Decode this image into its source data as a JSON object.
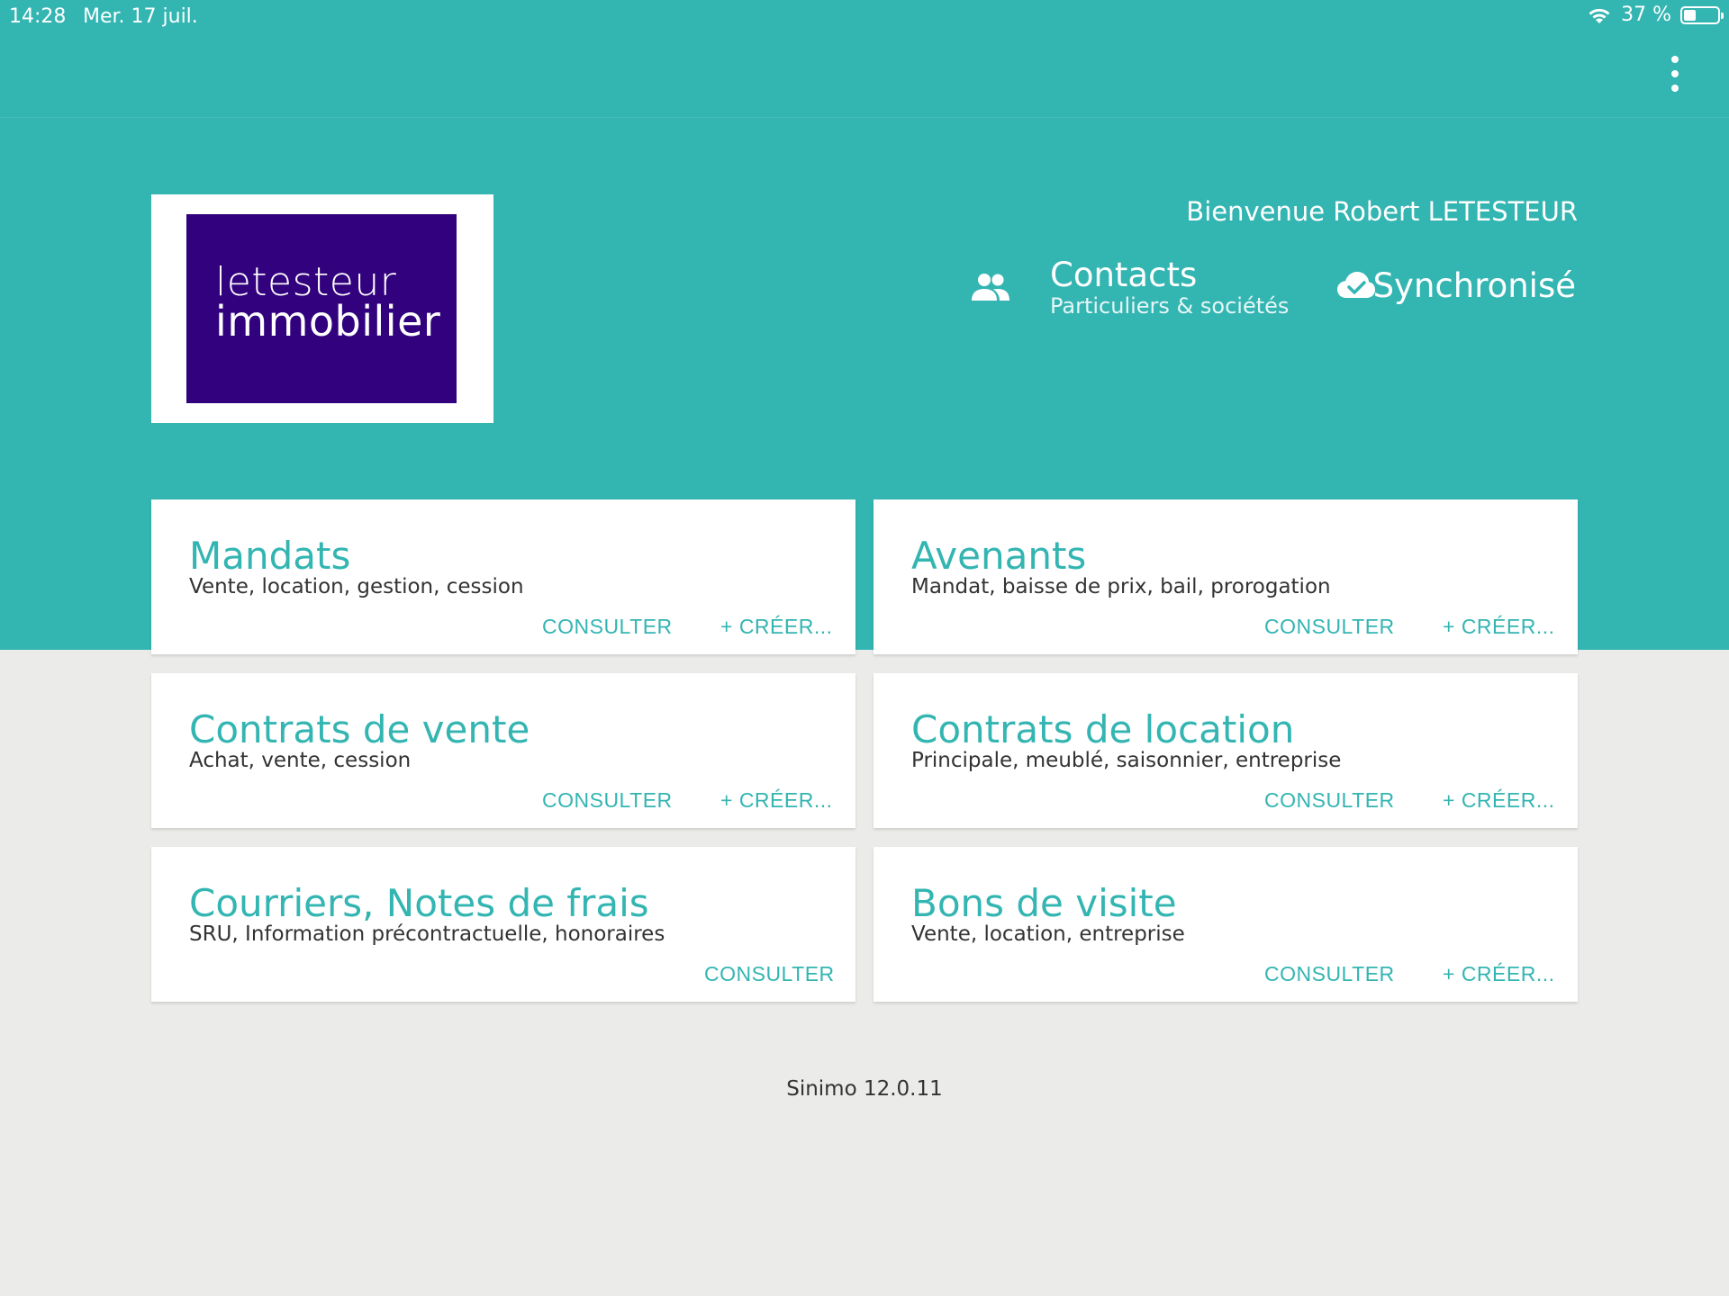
{
  "status_bar": {
    "time": "14:28",
    "date": "Mer. 17 juil.",
    "battery": "37 %",
    "battery_level": 0.37
  },
  "header": {
    "logo": {
      "line1": "letesteur",
      "line2": "immobilier"
    },
    "welcome": "Bienvenue Robert LETESTEUR",
    "contacts": {
      "title": "Contacts",
      "subtitle": "Particuliers & sociétés"
    },
    "sync_label": "Synchronisé"
  },
  "cards": [
    {
      "title": "Mandats",
      "subtitle": "Vente, location, gestion, cession",
      "consult_label": "CONSULTER",
      "create_label": "+ CRÉER..."
    },
    {
      "title": "Avenants",
      "subtitle": "Mandat, baisse de prix, bail, prorogation",
      "consult_label": "CONSULTER",
      "create_label": "+ CRÉER..."
    },
    {
      "title": "Contrats de vente",
      "subtitle": "Achat, vente, cession",
      "consult_label": "CONSULTER",
      "create_label": "+ CRÉER..."
    },
    {
      "title": "Contrats de location",
      "subtitle": "Principale, meublé, saisonnier, entreprise",
      "consult_label": "CONSULTER",
      "create_label": "+ CRÉER..."
    },
    {
      "title": "Courriers, Notes de frais",
      "subtitle": "SRU, Information précontractuelle, honoraires",
      "consult_label": "CONSULTER"
    },
    {
      "title": "Bons de visite",
      "subtitle": "Vente, location, entreprise",
      "consult_label": "CONSULTER",
      "create_label": "+ CRÉER..."
    }
  ],
  "footer": {
    "version": "Sinimo 12.0.11"
  },
  "colors": {
    "accent": "#33b5b2",
    "logo_bg": "#32017d",
    "page_bg": "#ebebea"
  }
}
